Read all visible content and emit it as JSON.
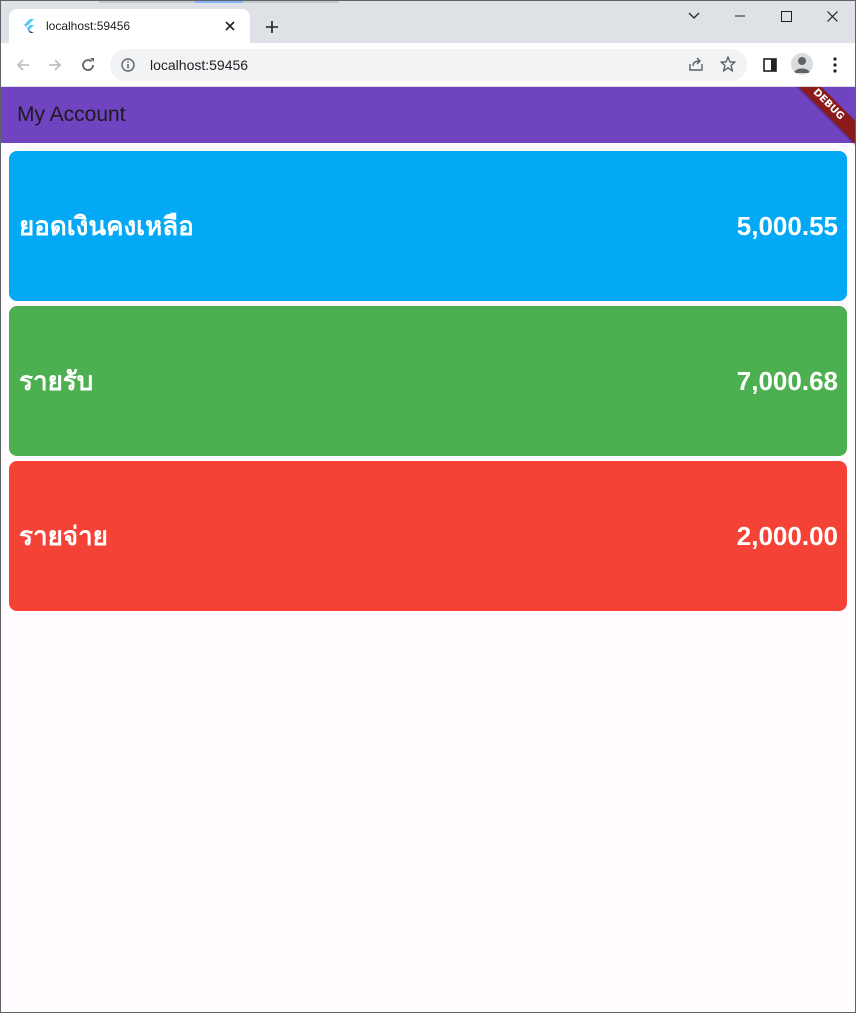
{
  "browser": {
    "tab": {
      "title": "localhost:59456"
    },
    "address": {
      "url": "localhost:59456"
    }
  },
  "app": {
    "title": "My Account",
    "debug_banner": "DEBUG",
    "cards": [
      {
        "label": "ยอดเงินคงเหลือ",
        "value": "5,000.55",
        "color": "#03a9f4"
      },
      {
        "label": "รายรับ",
        "value": "7,000.68",
        "color": "#4caf50"
      },
      {
        "label": "รายจ่าย",
        "value": "2,000.00",
        "color": "#f44336"
      }
    ]
  },
  "colors": {
    "appbar": "#7043c0",
    "background": "#fffbfe"
  }
}
